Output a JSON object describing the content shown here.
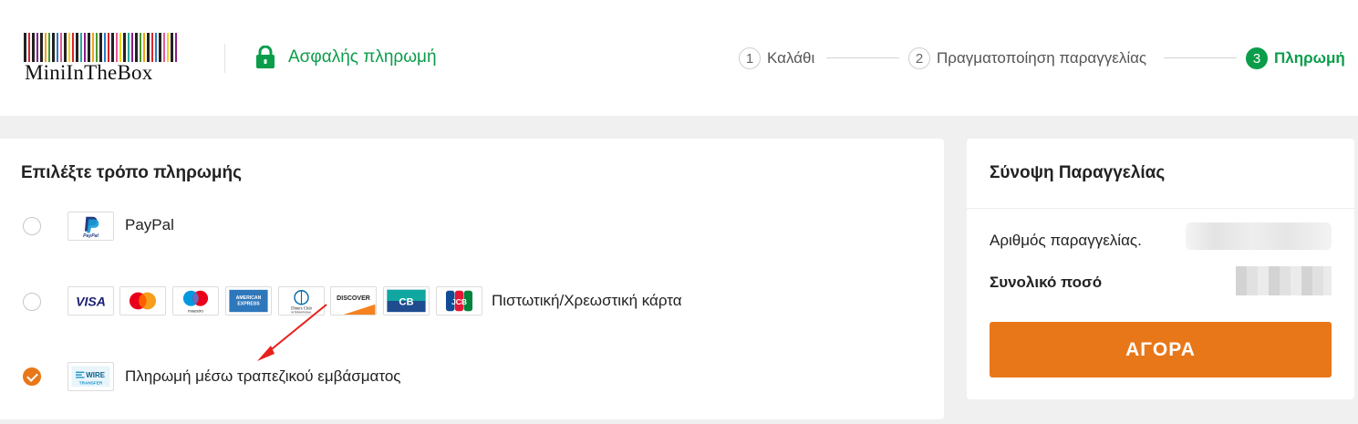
{
  "header": {
    "logo_text": "MiniInTheBox",
    "secure_label": "Ασφαλής πληρωμή",
    "steps": [
      {
        "num": "1",
        "label": "Καλάθι"
      },
      {
        "num": "2",
        "label": "Πραγματοποίηση παραγγελίας"
      },
      {
        "num": "3",
        "label": "Πληρωμή"
      }
    ],
    "active_step": 3
  },
  "payment": {
    "title": "Επιλέξτε τρόπο πληρωμής",
    "methods": [
      {
        "label": "PayPal",
        "selected": false,
        "icons": [
          "paypal-icon"
        ]
      },
      {
        "label": "Πιστωτική/Χρεωστική κάρτα",
        "selected": false,
        "icons": [
          "visa-icon",
          "mastercard-icon",
          "maestro-icon",
          "american-express-icon",
          "diners-club-icon",
          "discover-icon",
          "cb-icon",
          "jcb-icon"
        ]
      },
      {
        "label": "Πληρωμή μέσω τραπεζικού εμβάσματος",
        "selected": true,
        "icons": [
          "wire-transfer-icon"
        ]
      }
    ],
    "icon_text": {
      "paypal": "PayPal",
      "visa": "VISA",
      "maestro": "maestro",
      "amex_1": "AMERICAN",
      "amex_2": "EXPRESS",
      "diners_1": "Diners Club",
      "diners_2": "INTERNATIONAL",
      "discover": "DISCOVER",
      "cb": "CB",
      "jcb": "JCB",
      "wire_1": "WIRE",
      "wire_2": "TRANSFER"
    }
  },
  "summary": {
    "title": "Σύνοψη Παραγγελίας",
    "order_number_label": "Αριθμός παραγγελίας.",
    "total_label": "Συνολικό ποσό",
    "buy_button": "ΑΓΟΡΑ"
  },
  "colors": {
    "accent_green": "#0b9d4a",
    "buy_orange": "#e8771a",
    "annotation_arrow": "#e8201c"
  }
}
